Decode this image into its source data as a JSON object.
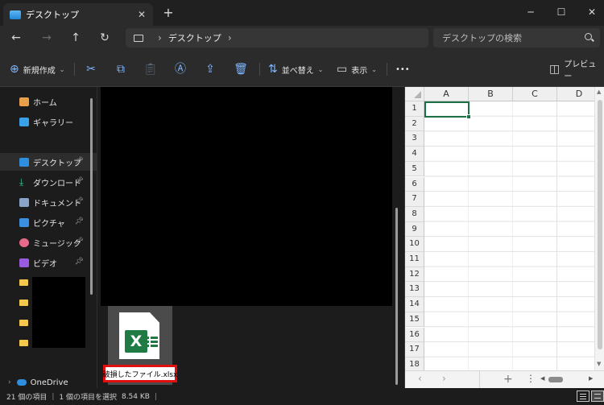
{
  "window": {
    "tab_title": "デスクトップ",
    "tab_close": "✕",
    "new_tab": "+",
    "minimize": "─",
    "maximize": "☐",
    "close": "✕"
  },
  "nav": {
    "back": "←",
    "forward": "→",
    "up": "↑",
    "refresh": "↻",
    "breadcrumb": "デスクトップ",
    "separator": "›",
    "search_placeholder": "デスクトップの検索"
  },
  "toolbar": {
    "new_label": "新規作成",
    "sort_label": "並べ替え",
    "view_label": "表示",
    "more": "•••",
    "preview_label": "プレビュー"
  },
  "sidebar": {
    "items": [
      {
        "label": "ホーム",
        "icon": "home-icon"
      },
      {
        "label": "ギャラリー",
        "icon": "gallery-icon"
      },
      {
        "label": "デスクトップ",
        "icon": "desktop-icon",
        "selected": true,
        "pinned": true
      },
      {
        "label": "ダウンロード",
        "icon": "download-icon",
        "pinned": true
      },
      {
        "label": "ドキュメント",
        "icon": "documents-icon",
        "pinned": true
      },
      {
        "label": "ピクチャ",
        "icon": "pictures-icon",
        "pinned": true
      },
      {
        "label": "ミュージック",
        "icon": "music-icon",
        "pinned": true
      },
      {
        "label": "ビデオ",
        "icon": "videos-icon",
        "pinned": true
      }
    ],
    "onedrive_label": "OneDrive"
  },
  "file": {
    "name": "破損したファイル.xlsx",
    "excel_letter": "X"
  },
  "preview": {
    "columns": [
      "A",
      "B",
      "C",
      "D"
    ],
    "rows": [
      "1",
      "2",
      "3",
      "4",
      "5",
      "6",
      "7",
      "8",
      "9",
      "10",
      "11",
      "12",
      "13",
      "14",
      "15",
      "16",
      "17",
      "18"
    ]
  },
  "status": {
    "item_count": "21 個の項目",
    "selection": "1 個の項目を選択",
    "size": "8.54 KB"
  },
  "colors": {
    "highlight_border": "#e01010",
    "excel_green": "#1f7a44",
    "accent_blue": "#7fb6ff"
  }
}
